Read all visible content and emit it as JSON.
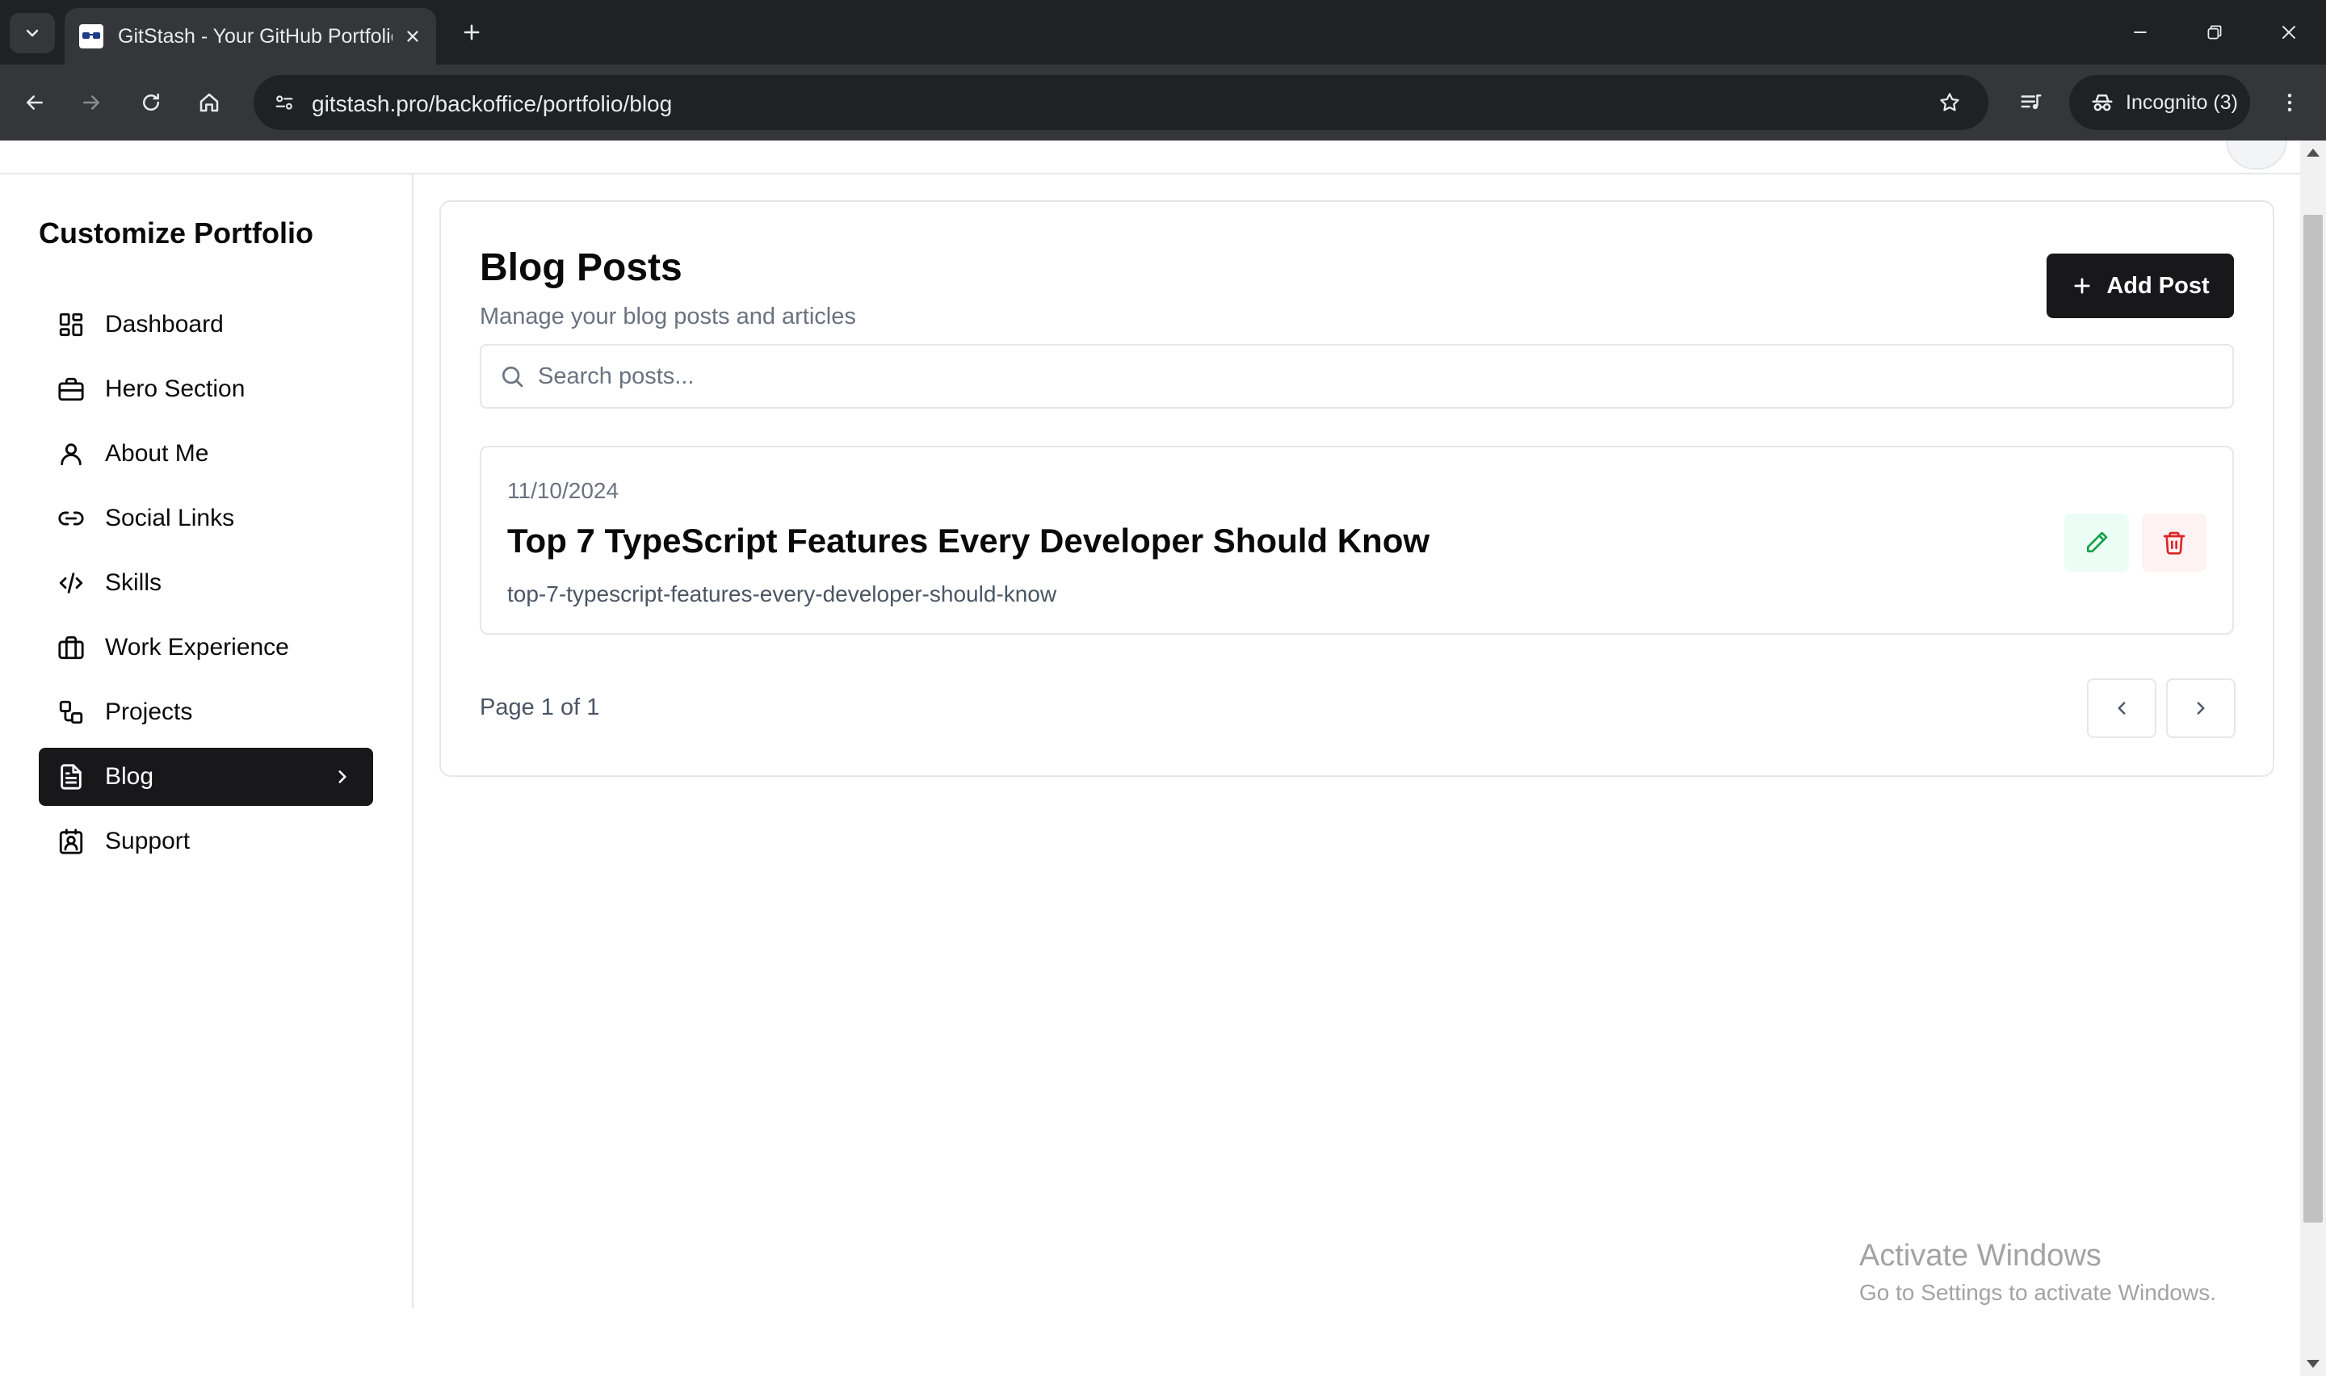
{
  "browser": {
    "tab_title": "GitStash - Your GitHub Portfolio",
    "url": "gitstash.pro/backoffice/portfolio/blog",
    "incognito_label": "Incognito (3)"
  },
  "sidebar": {
    "title": "Customize Portfolio",
    "items": [
      {
        "label": "Dashboard",
        "icon": "dashboard-icon"
      },
      {
        "label": "Hero Section",
        "icon": "briefcase-icon"
      },
      {
        "label": "About Me",
        "icon": "user-icon"
      },
      {
        "label": "Social Links",
        "icon": "link-icon"
      },
      {
        "label": "Skills",
        "icon": "code-icon"
      },
      {
        "label": "Work Experience",
        "icon": "briefcase-icon"
      },
      {
        "label": "Projects",
        "icon": "projects-icon"
      },
      {
        "label": "Blog",
        "icon": "file-text-icon",
        "active": true
      },
      {
        "label": "Support",
        "icon": "contact-icon"
      }
    ]
  },
  "main": {
    "title": "Blog Posts",
    "description": "Manage your blog posts and articles",
    "add_button_label": "Add Post",
    "search_placeholder": "Search posts...",
    "posts": [
      {
        "date": "11/10/2024",
        "title": "Top 7 TypeScript Features Every Developer Should Know",
        "slug": "top-7-typescript-features-every-developer-should-know"
      }
    ],
    "pagination_text": "Page 1 of 1"
  },
  "os_watermark": {
    "title": "Activate Windows",
    "subtitle": "Go to Settings to activate Windows."
  },
  "colors": {
    "primary": "#18181b",
    "edit_icon": "#16a34a",
    "edit_bg": "#ecfdf5",
    "delete_icon": "#dc2626",
    "delete_bg": "#fef2f2",
    "muted_text": "#6b7280",
    "border": "#e5e7eb"
  }
}
